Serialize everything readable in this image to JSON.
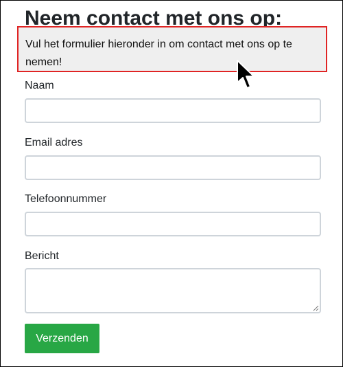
{
  "page": {
    "title": "Neem contact met ons op:"
  },
  "tooltip": {
    "text": "Vul het formulier hieronder in om contact met ons op te nemen!"
  },
  "form": {
    "fields": [
      {
        "label": "Naam",
        "value": "",
        "placeholder": ""
      },
      {
        "label": "Email adres",
        "value": "",
        "placeholder": ""
      },
      {
        "label": "Telefoonnummer",
        "value": "",
        "placeholder": ""
      },
      {
        "label": "Bericht",
        "value": "",
        "placeholder": ""
      }
    ],
    "submit_label": "Verzenden"
  },
  "icons": {
    "cursor": "mouse-pointer-icon",
    "resize": "resize-grip-icon"
  },
  "colors": {
    "submit_bg": "#28a745",
    "tooltip_border": "#e02424",
    "tooltip_bg": "#efefef",
    "input_border": "#ced4da"
  }
}
